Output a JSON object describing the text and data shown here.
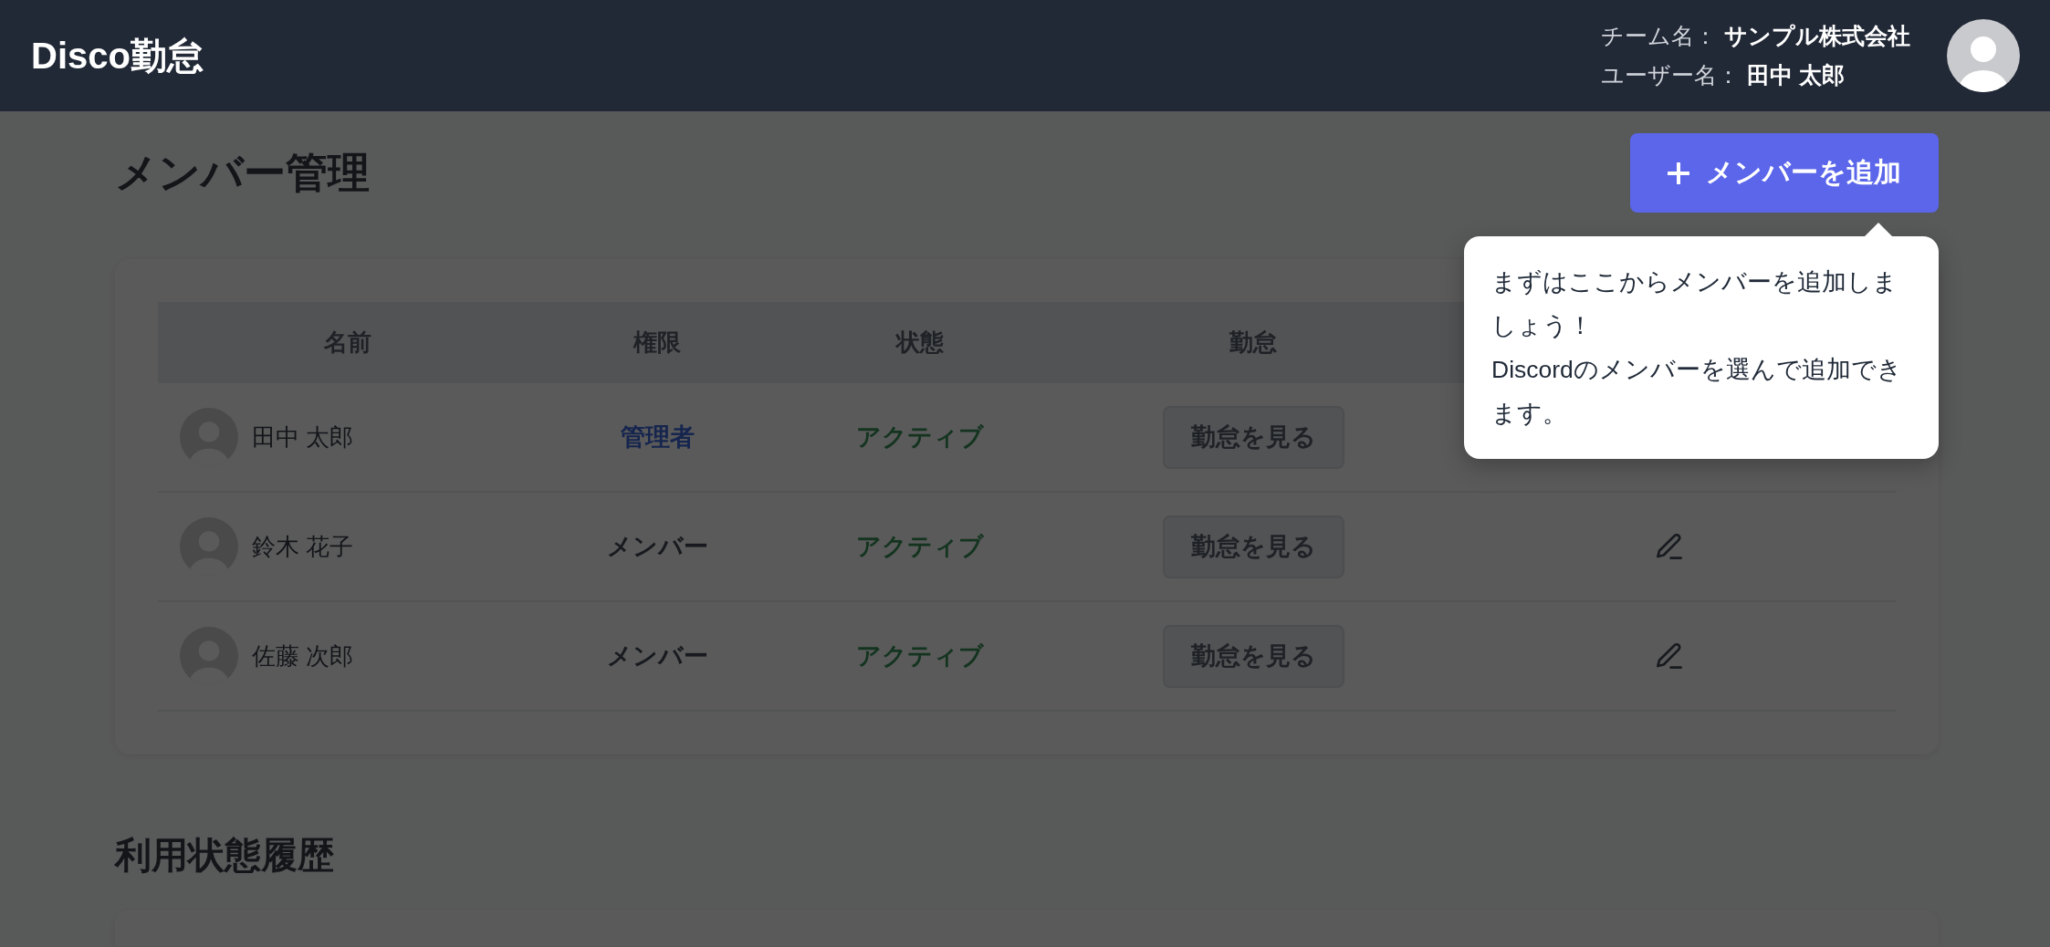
{
  "header": {
    "title": "Disco勤怠",
    "team_label": "チーム名：",
    "team_name": "サンプル株式会社",
    "user_label": "ユーザー名：",
    "user_name": "田中 太郎"
  },
  "page": {
    "title": "メンバー管理",
    "add_button": "メンバーを追加"
  },
  "tooltip": {
    "lines": [
      "まずはここからメンバーを追加しましょう！",
      "Discordのメンバーを選んで追加できます。"
    ]
  },
  "members": {
    "columns": [
      "名前",
      "権限",
      "状態",
      "勤怠"
    ],
    "rows": [
      {
        "name": "田中 太郎",
        "role": {
          "text": "管理者",
          "kind": "admin"
        },
        "status": "アクティブ",
        "attendance_button": "勤怠を見る",
        "edit_icon": false
      },
      {
        "name": "鈴木 花子",
        "role": {
          "text": "メンバー",
          "kind": "member"
        },
        "status": "アクティブ",
        "attendance_button": "勤怠を見る",
        "edit_icon": true
      },
      {
        "name": "佐藤 次郎",
        "role": {
          "text": "メンバー",
          "kind": "member"
        },
        "status": "アクティブ",
        "attendance_button": "勤怠を見る",
        "edit_icon": true
      }
    ]
  },
  "history": {
    "title": "利用状態履歴"
  }
}
